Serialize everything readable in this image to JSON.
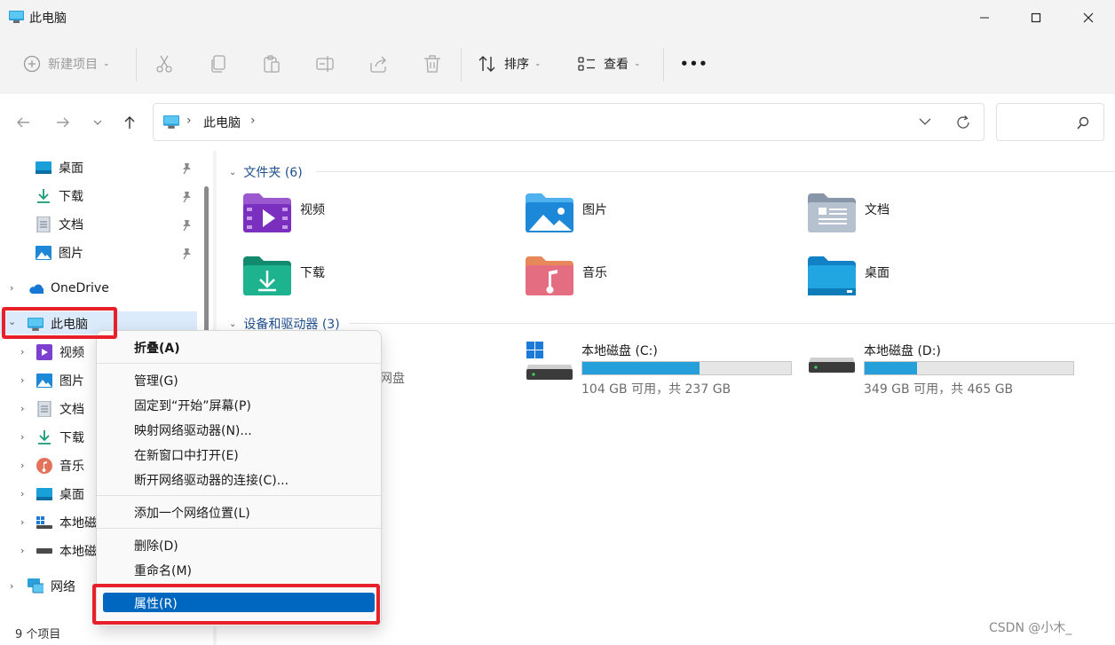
{
  "window": {
    "title": "此电脑"
  },
  "toolbar": {
    "new_item": "新建项目",
    "sort": "排序",
    "view": "查看",
    "more": "•••"
  },
  "address": {
    "crumb": "此电脑",
    "sep": "›"
  },
  "sidebar": {
    "quick": [
      {
        "label": "桌面"
      },
      {
        "label": "下载"
      },
      {
        "label": "文档"
      },
      {
        "label": "图片"
      }
    ],
    "onedrive": "OneDrive",
    "this_pc": "此电脑",
    "pc_children": [
      {
        "label": "视频"
      },
      {
        "label": "图片"
      },
      {
        "label": "文档"
      },
      {
        "label": "下载"
      },
      {
        "label": "音乐"
      },
      {
        "label": "桌面"
      },
      {
        "label": "本地磁"
      },
      {
        "label": "本地磁"
      }
    ],
    "network": "网络"
  },
  "status": {
    "count": "9 个项目"
  },
  "main": {
    "folders_header": "文件夹 (6)",
    "folders": [
      {
        "label": "视频"
      },
      {
        "label": "图片"
      },
      {
        "label": "文档"
      },
      {
        "label": "下载"
      },
      {
        "label": "音乐"
      },
      {
        "label": "桌面"
      }
    ],
    "drives_header": "设备和驱动器 (3)",
    "partial_label": "网盘",
    "drives": [
      {
        "name": "本地磁盘 (C:)",
        "free": "104 GB 可用，共 237 GB",
        "used_fraction": 0.561
      },
      {
        "name": "本地磁盘 (D:)",
        "free": "349 GB 可用，共 465 GB",
        "used_fraction": 0.249
      }
    ]
  },
  "context_menu": {
    "items": [
      {
        "label": "折叠(A)"
      },
      {
        "label": "管理(G)"
      },
      {
        "label": "固定到“开始”屏幕(P)"
      },
      {
        "label": "映射网络驱动器(N)..."
      },
      {
        "label": "在新窗口中打开(E)"
      },
      {
        "label": "断开网络驱动器的连接(C)..."
      },
      {
        "label": "添加一个网络位置(L)"
      },
      {
        "label": "删除(D)"
      },
      {
        "label": "重命名(M)"
      },
      {
        "label": "属性(R)"
      }
    ]
  },
  "watermark": "CSDN @小木_"
}
